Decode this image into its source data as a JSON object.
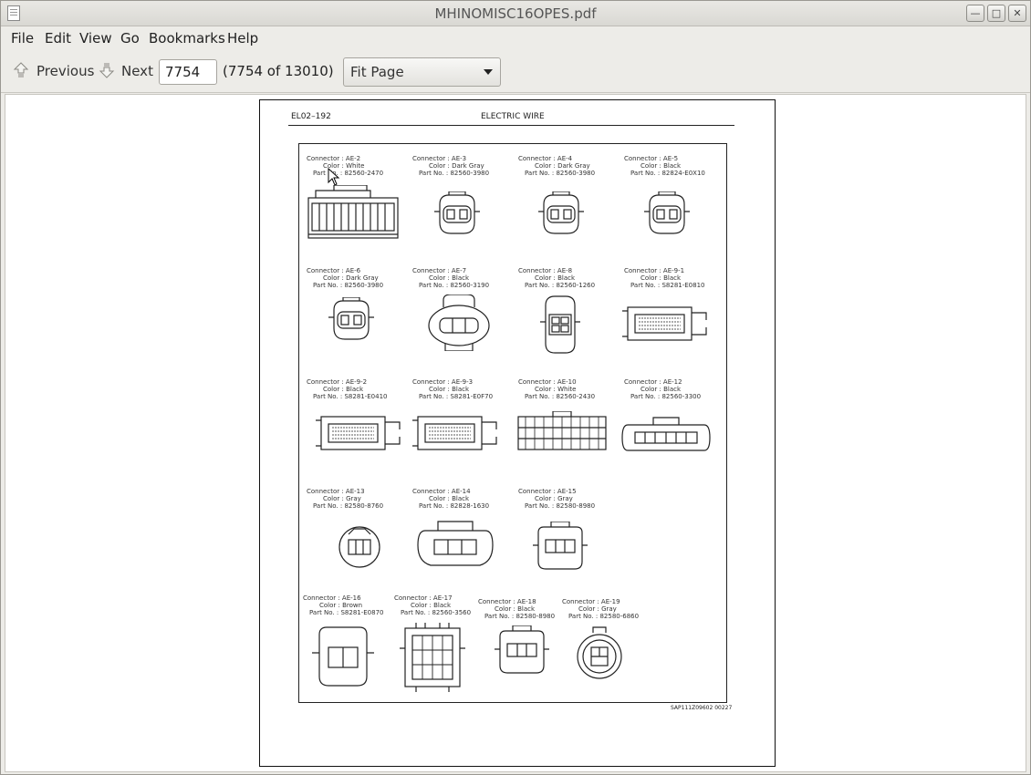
{
  "window": {
    "title": "MHINOMISC16OPES.pdf"
  },
  "menu": [
    "File",
    "Edit",
    "View",
    "Go",
    "Bookmarks",
    "Help"
  ],
  "toolbar": {
    "previous_label": "Previous",
    "next_label": "Next",
    "page_value": "7754",
    "page_count": "(7754 of 13010)",
    "zoom_value": "Fit Page"
  },
  "document": {
    "header_code": "EL02–192",
    "header_title": "ELECTRIC WIRE",
    "footer_code": "SAP111Z09602 00227",
    "connectors": [
      {
        "connector": "Connector : AE-2",
        "color": "Color : White",
        "part": "Part No. : 82560-2470",
        "kind": "ae2"
      },
      {
        "connector": "Connector : AE-3",
        "color": "Color : Dark Gray",
        "part": "Part No. : 82560-3980",
        "kind": "small2"
      },
      {
        "connector": "Connector : AE-4",
        "color": "Color : Dark Gray",
        "part": "Part No. : 82560-3980",
        "kind": "small2"
      },
      {
        "connector": "Connector : AE-5",
        "color": "Color : Black",
        "part": "Part No. : 82824-E0X10",
        "kind": "small2"
      },
      {
        "connector": "Connector : AE-6",
        "color": "Color : Dark Gray",
        "part": "Part No. : 82560-3980",
        "kind": "small2"
      },
      {
        "connector": "Connector : AE-7",
        "color": "Color : Black",
        "part": "Part No. : 82560-3190",
        "kind": "oval2"
      },
      {
        "connector": "Connector : AE-8",
        "color": "Color : Black",
        "part": "Part No. : 82560-1260",
        "kind": "four"
      },
      {
        "connector": "Connector : AE-9-1",
        "color": "Color : Black",
        "part": "Part No. : S8281-E0810",
        "kind": "ecu"
      },
      {
        "connector": "Connector : AE-9-2",
        "color": "Color : Black",
        "part": "Part No. : S8281-E0410",
        "kind": "ecu"
      },
      {
        "connector": "Connector : AE-9-3",
        "color": "Color : Black",
        "part": "Part No. : S8281-E0F70",
        "kind": "ecu"
      },
      {
        "connector": "Connector : AE-10",
        "color": "Color : White",
        "part": "Part No. : 82560-2430",
        "kind": "block"
      },
      {
        "connector": "Connector : AE-12",
        "color": "Color : Black",
        "part": "Part No. : 82560-3300",
        "kind": "row6"
      },
      {
        "connector": "Connector : AE-13",
        "color": "Color : Gray",
        "part": "Part No. : 82580-8760",
        "kind": "round3"
      },
      {
        "connector": "Connector : AE-14",
        "color": "Color : Black",
        "part": "Part No. : 82828-1630",
        "kind": "wide3"
      },
      {
        "connector": "Connector : AE-15",
        "color": "Color : Gray",
        "part": "Part No. : 82580-8980",
        "kind": "square3"
      },
      {
        "connector": "Connector : AE-16",
        "color": "Color : Brown",
        "part": "Part No. : S8281-E0870",
        "kind": "square2"
      },
      {
        "connector": "Connector : AE-17",
        "color": "Color : Black",
        "part": "Part No. : 82560-3560",
        "kind": "tall"
      },
      {
        "connector": "Connector : AE-18",
        "color": "Color : Black",
        "part": "Part No. : 82580-8980",
        "kind": "square3"
      },
      {
        "connector": "Connector : AE-19",
        "color": "Color : Gray",
        "part": "Part No. : 82580-6860",
        "kind": "circle3"
      }
    ]
  }
}
